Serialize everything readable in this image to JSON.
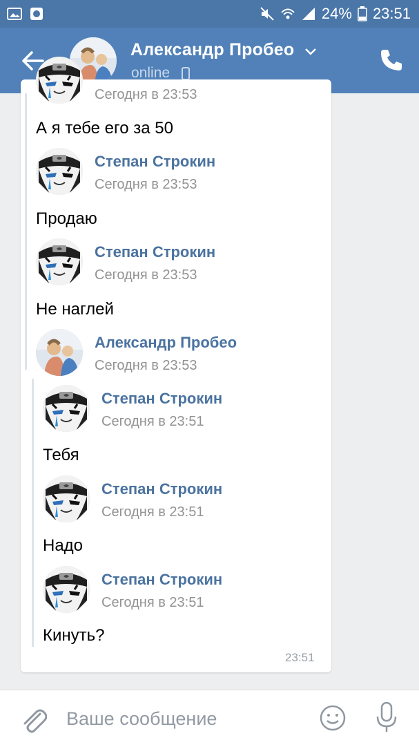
{
  "status_bar": {
    "battery": "24%",
    "time": "23:51"
  },
  "header": {
    "contact_name": "Александр Пробео",
    "presence": "online"
  },
  "messages": [
    {
      "sender": "",
      "time": "Сегодня в 23:53",
      "text": "А я тебе его за 50",
      "avatar": "naruto-avatar"
    },
    {
      "sender": "Степан Строкин",
      "time": "Сегодня в 23:53",
      "text": "Продаю",
      "avatar": "naruto-avatar"
    },
    {
      "sender": "Степан Строкин",
      "time": "Сегодня в 23:53",
      "text": "Не наглей",
      "avatar": "naruto-avatar"
    },
    {
      "sender": "Александр Пробео",
      "time": "Сегодня в 23:53",
      "text": "",
      "avatar": "photo-avatar"
    },
    {
      "sender": "Степан Строкин",
      "time": "Сегодня в 23:51",
      "text": "Тебя",
      "avatar": "naruto-avatar"
    },
    {
      "sender": "Степан Строкин",
      "time": "Сегодня в 23:51",
      "text": "Надо",
      "avatar": "naruto-avatar"
    },
    {
      "sender": "Степан Строкин",
      "time": "Сегодня в 23:51",
      "text": "Кинуть?",
      "avatar": "naruto-avatar"
    }
  ],
  "message_timestamp": "23:51",
  "composer": {
    "placeholder": "Ваше сообщение"
  },
  "colors": {
    "status_bar": "#4a76a8",
    "header": "#5181b8",
    "sender_name": "#4b73a0",
    "background": "#edeef0"
  }
}
